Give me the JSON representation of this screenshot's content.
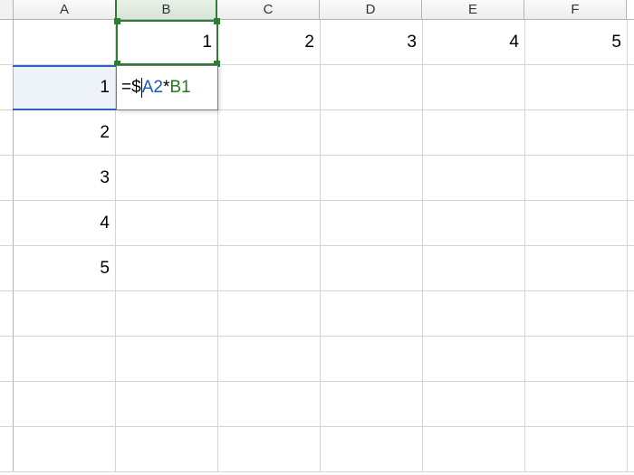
{
  "columns": [
    "A",
    "B",
    "C",
    "D",
    "E",
    "F"
  ],
  "rows": [
    {
      "A": "",
      "B": "1",
      "C": "2",
      "D": "3",
      "E": "4",
      "F": "5"
    },
    {
      "A": "1",
      "B": "",
      "C": "",
      "D": "",
      "E": "",
      "F": ""
    },
    {
      "A": "2",
      "B": "",
      "C": "",
      "D": "",
      "E": "",
      "F": ""
    },
    {
      "A": "3",
      "B": "",
      "C": "",
      "D": "",
      "E": "",
      "F": ""
    },
    {
      "A": "4",
      "B": "",
      "C": "",
      "D": "",
      "E": "",
      "F": ""
    },
    {
      "A": "5",
      "B": "",
      "C": "",
      "D": "",
      "E": "",
      "F": ""
    },
    {
      "A": "",
      "B": "",
      "C": "",
      "D": "",
      "E": "",
      "F": ""
    },
    {
      "A": "",
      "B": "",
      "C": "",
      "D": "",
      "E": "",
      "F": ""
    },
    {
      "A": "",
      "B": "",
      "C": "",
      "D": "",
      "E": "",
      "F": ""
    },
    {
      "A": "",
      "B": "",
      "C": "",
      "D": "",
      "E": "",
      "F": ""
    }
  ],
  "editing": {
    "cell": "B2",
    "formula_parts": {
      "eq": "=",
      "dollar": "$",
      "ref1": "A2",
      "star": "*",
      "ref2": "B1"
    },
    "formula_raw": "=$A2*B1"
  },
  "active_column": "B",
  "referenced_cells": [
    {
      "ref": "A2",
      "color": "#2f5ec4"
    },
    {
      "ref": "B1",
      "color": "#2e7d32"
    }
  ]
}
